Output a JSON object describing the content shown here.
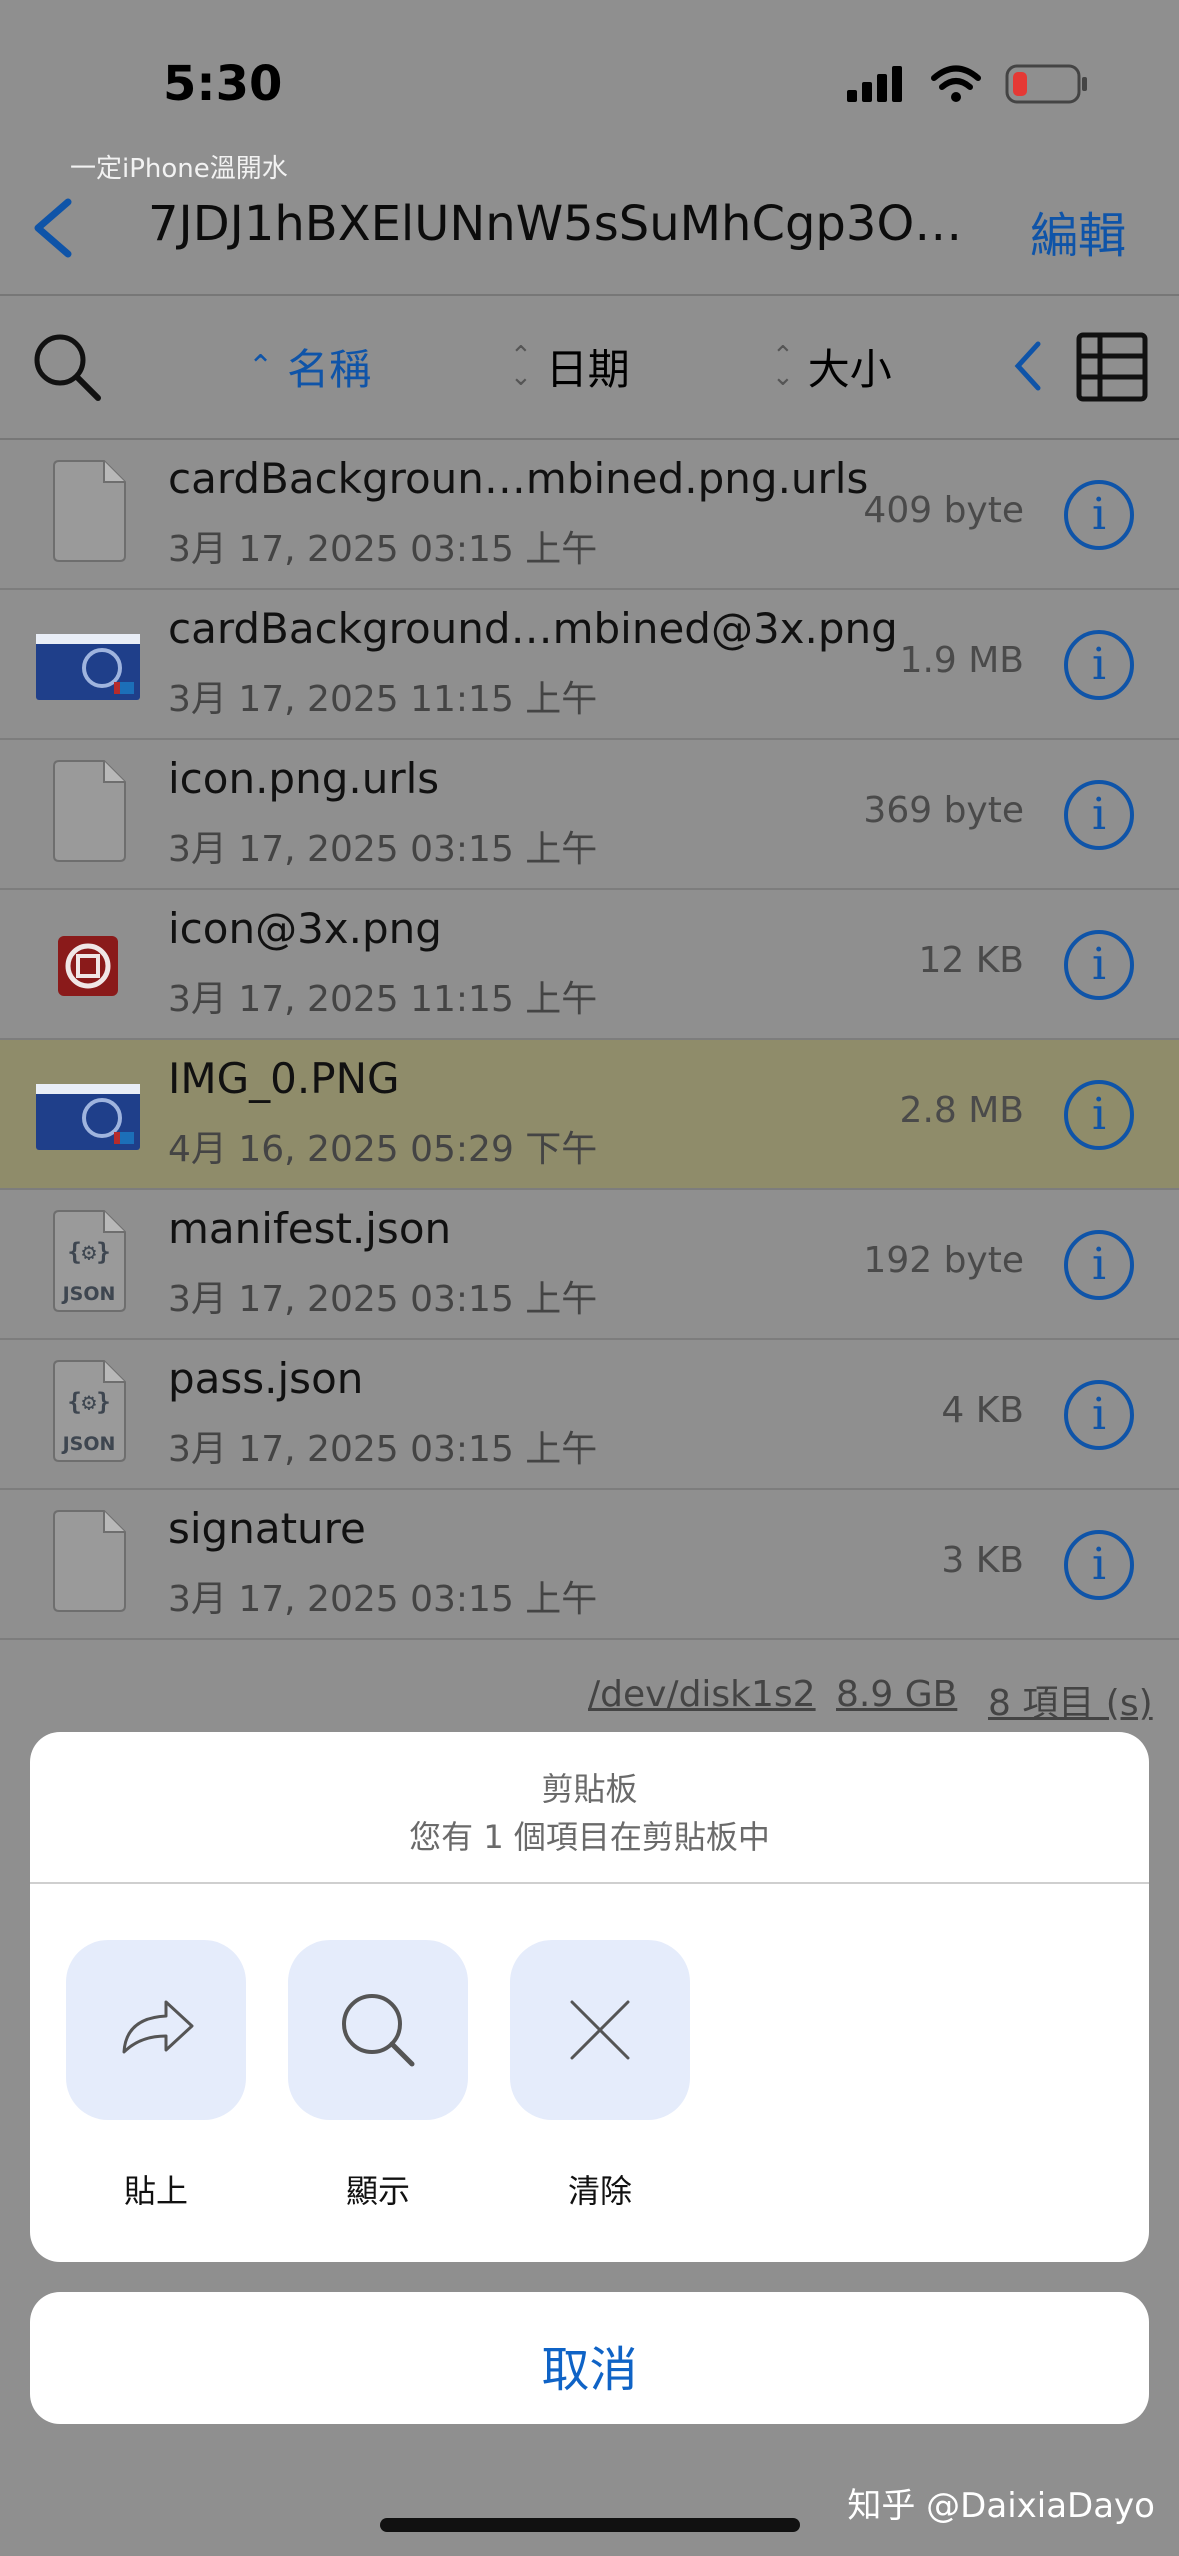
{
  "status": {
    "time": "5:30",
    "carrier_note": "一定iPhone溫開水"
  },
  "nav": {
    "title": "7JDJ1hBXElUNnW5sSuMhCgp3O…",
    "edit": "編輯"
  },
  "toolbar": {
    "sort_name": "名稱",
    "sort_date": "日期",
    "sort_size": "大小"
  },
  "files": [
    {
      "name": "cardBackgroun…mbined.png.urls",
      "date": "3月 17, 2025 03:15 上午",
      "size": "409 byte",
      "icon": "document-icon"
    },
    {
      "name": "cardBackground…mbined@3x.png",
      "date": "3月 17, 2025 11:15 上午",
      "size": "1.9 MB",
      "icon": "card-thumbnail"
    },
    {
      "name": "icon.png.urls",
      "date": "3月 17, 2025 03:15 上午",
      "size": "369 byte",
      "icon": "document-icon"
    },
    {
      "name": "icon@3x.png",
      "date": "3月 17, 2025 11:15 上午",
      "size": "12 KB",
      "icon": "bank-logo-thumbnail"
    },
    {
      "name": "IMG_0.PNG",
      "date": "4月 16, 2025 05:29 下午",
      "size": "2.8 MB",
      "icon": "card-thumbnail",
      "selected": true
    },
    {
      "name": "manifest.json",
      "date": "3月 17, 2025 03:15 上午",
      "size": "192 byte",
      "icon": "json-icon"
    },
    {
      "name": "pass.json",
      "date": "3月 17, 2025 03:15 上午",
      "size": "4 KB",
      "icon": "json-icon"
    },
    {
      "name": "signature",
      "date": "3月 17, 2025 03:15 上午",
      "size": "3 KB",
      "icon": "document-icon"
    }
  ],
  "footer": {
    "disk": "/dev/disk1s2",
    "free": "8.9 GB",
    "count": "8 項目 (s)"
  },
  "sheet": {
    "title": "剪貼板",
    "subtitle": "您有 1 個項目在剪貼板中",
    "actions": [
      {
        "label": "貼上"
      },
      {
        "label": "顯示"
      },
      {
        "label": "清除"
      }
    ],
    "cancel": "取消"
  },
  "watermark": "知乎 @DaixiaDayo",
  "colors": {
    "accent": "#0f54a8",
    "selected_row": "#8f8c6a",
    "action_tile": "#e5ecfb"
  }
}
